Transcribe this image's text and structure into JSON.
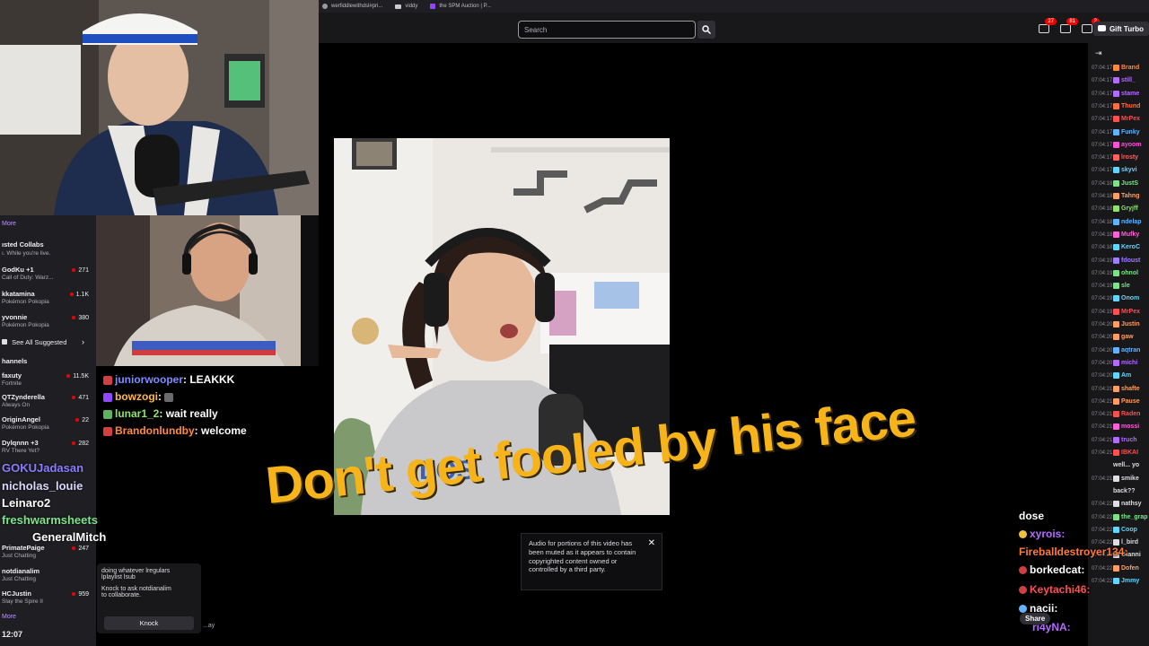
{
  "bookmarks": [
    {
      "label": "werfiddlewithdsl#pri..."
    },
    {
      "label": "viddy"
    },
    {
      "label": "the SPM Auction | P..."
    }
  ],
  "topbar": {
    "search_placeholder": "Search",
    "badges": [
      "27",
      "81",
      "2"
    ],
    "gift_label": "Gift Turbo"
  },
  "sidebar": {
    "more_label": "More",
    "collab_title": "ısted Collabs",
    "collab_sub": "ı. While you're live.",
    "suggested": [
      {
        "name": "GodKu +1",
        "game": "Call of Duty: Warz...",
        "viewers": "271"
      },
      {
        "name": "kkatamina",
        "game": "Pokémon Pokopia",
        "viewers": "1.1K"
      },
      {
        "name": "yvonnie",
        "game": "Pokémon Pokopia",
        "viewers": "380"
      }
    ],
    "see_all": "See All Suggested",
    "channels_title": "hannels",
    "channels": [
      {
        "name": "faxuty",
        "game": "Fortnite",
        "viewers": "11.5K"
      },
      {
        "name": "QTZynderella",
        "game": "Always On",
        "viewers": "471"
      },
      {
        "name": "OriginAngel",
        "game": "Pokémon Pokopia",
        "viewers": "22"
      },
      {
        "name": "Dylqnnn +3",
        "game": "RV There Yet?",
        "viewers": "282"
      }
    ],
    "bottom_channels": [
      {
        "name": "PrimatePaige",
        "game": "Just Chatting",
        "viewers": "247"
      },
      {
        "name": "notdianalim",
        "game": "Just Chatting",
        "viewers": ""
      },
      {
        "name": "HCJustin",
        "game": "Slay the Spire II",
        "viewers": "959"
      }
    ],
    "more_label_2": "More",
    "clock": "12:07"
  },
  "left_chat": [
    {
      "user": "juniorwooper",
      "color": "#7f8cff",
      "msg": "LEAKKK"
    },
    {
      "user": "bowzogi",
      "color": "#ffb84d",
      "msg": ""
    },
    {
      "user": "lunar1_2",
      "color": "#8ee36b",
      "msg": "wait really"
    },
    {
      "user": "Brandonlundby",
      "color": "#ff8a3d",
      "msg": "welcome"
    }
  ],
  "overlay_users": [
    {
      "user": "GOKUJadasan",
      "color": "#8a7dff"
    },
    {
      "user": "nicholas_louie",
      "color": "#d9d9ff"
    },
    {
      "user": "Leinaro2",
      "color": "#ffffff"
    },
    {
      "user": "freshwarmsheets",
      "color": "#7de38a"
    },
    {
      "user": "GeneralMitch",
      "color": "#ffffff"
    }
  ],
  "knock": {
    "line1": "doing whatever lregulars",
    "line2": "lplaylist lsub",
    "line3": "Knock to ask notdianalim",
    "line4": "to collaborate.",
    "button": "Knock",
    "under": "...ay"
  },
  "caption": "Don't get fooled by his face",
  "toast": {
    "text": "Audio for portions of this video has been muted as it appears to contain copyrighted content owned or controlled by a third party.",
    "close": "✕"
  },
  "right_chat": {
    "collapse_icon": "arrow-right-to-line-icon",
    "rows": [
      {
        "time": "07:04:17",
        "user": "Brand",
        "color": "#ff8a3d"
      },
      {
        "time": "07:04:17",
        "user": "still_",
        "color": "#b36bff"
      },
      {
        "time": "07:04:17",
        "user": "stame",
        "color": "#b36bff"
      },
      {
        "time": "07:04:17",
        "user": "Thund",
        "color": "#ff6f3d"
      },
      {
        "time": "07:04:17",
        "user": "MrPex",
        "color": "#ff4f4f"
      },
      {
        "time": "07:04:17",
        "user": "Funky",
        "color": "#5fb3ff"
      },
      {
        "time": "07:04:17",
        "user": "ayoom",
        "color": "#ff4fd8"
      },
      {
        "time": "07:04:17",
        "user": "lrosty",
        "color": "#ff5f5f"
      },
      {
        "time": "07:04:17",
        "user": "skyvi",
        "color": "#5fd8ff"
      },
      {
        "time": "07:04:18",
        "user": "JustS",
        "color": "#7de38a"
      },
      {
        "time": "07:04:18",
        "user": "Tahng",
        "color": "#ff9f5f"
      },
      {
        "time": "07:04:18",
        "user": "Gryjff",
        "color": "#8ee36b"
      },
      {
        "time": "07:04:18",
        "user": "ndelap",
        "color": "#5fb3ff"
      },
      {
        "time": "07:04:18",
        "user": "Mufky",
        "color": "#ff5fd8"
      },
      {
        "time": "07:04:18",
        "user": "KeroC",
        "color": "#5fd8ff"
      },
      {
        "time": "07:04:19",
        "user": "fdoust",
        "color": "#9f7dff"
      },
      {
        "time": "07:04:19",
        "user": "ohnol",
        "color": "#7de38a"
      },
      {
        "time": "07:04:19",
        "user": "sle",
        "color": "#7de38a"
      },
      {
        "time": "07:04:19",
        "user": "Onom",
        "color": "#5fd8ff"
      },
      {
        "time": "07:04:19",
        "user": "MrPex",
        "color": "#ff4f4f"
      },
      {
        "time": "07:04:20",
        "user": "Justin",
        "color": "#ff9f5f"
      },
      {
        "time": "07:04:20",
        "user": "gaw",
        "color": "#ff9f5f"
      },
      {
        "time": "07:04:20",
        "user": "aqtran",
        "color": "#5fb3ff"
      },
      {
        "time": "07:04:20",
        "user": "michi",
        "color": "#b36bff"
      },
      {
        "time": "07:04:20",
        "user": "Am",
        "color": "#5fd8ff"
      },
      {
        "time": "07:04:21",
        "user": "shafte",
        "color": "#ff9f5f"
      },
      {
        "time": "07:04:21",
        "user": "Pause",
        "color": "#ff9f5f"
      },
      {
        "time": "07:04:21",
        "user": "Raden",
        "color": "#ff4f4f"
      },
      {
        "time": "07:04:21",
        "user": "mossi",
        "color": "#ff5fd8"
      },
      {
        "time": "07:04:21",
        "user": "truch",
        "color": "#b36bff"
      },
      {
        "time": "07:04:21",
        "user": "IBKAI",
        "color": "#ff4f4f"
      },
      {
        "time": "",
        "user": "well... yo",
        "color": "#dedee3"
      },
      {
        "time": "07:04:21",
        "user": "smike",
        "color": "#dedee3"
      },
      {
        "time": "",
        "user": "back??",
        "color": "#dedee3"
      },
      {
        "time": "07:04:22",
        "user": "nathsy",
        "color": "#dedee3"
      },
      {
        "time": "07:04:22",
        "user": "the_grap",
        "color": "#7de38a"
      },
      {
        "time": "07:04:22",
        "user": "Coop",
        "color": "#5fd8ff"
      },
      {
        "time": "07:04:22",
        "user": "l_bird",
        "color": "#dedee3"
      },
      {
        "time": "07:04:22",
        "user": "Gianni",
        "color": "#dedee3"
      },
      {
        "time": "07:04:22",
        "user": "Dofen",
        "color": "#ff9f5f"
      },
      {
        "time": "07:04:22",
        "user": "Jmmy",
        "color": "#5fd8ff"
      }
    ]
  },
  "br_chat": [
    {
      "user": "dose",
      "color": "#ffffff"
    },
    {
      "user": "xyrois:",
      "color": "#b36bff"
    },
    {
      "user": "Fireballdestroyer134:",
      "color": "#ff7a3d"
    },
    {
      "user": "borkedcat:",
      "color": "#ffffff"
    },
    {
      "user": "Keytachi46:",
      "color": "#ff4f4f"
    },
    {
      "user": "nacii:",
      "color": "#ffffff"
    },
    {
      "user": "ri4yNA:",
      "color": "#b36bff"
    }
  ],
  "share_label": "Share",
  "colors": {
    "accent": "#9147ff",
    "caption": "#f6b41a",
    "live": "#eb0400"
  }
}
